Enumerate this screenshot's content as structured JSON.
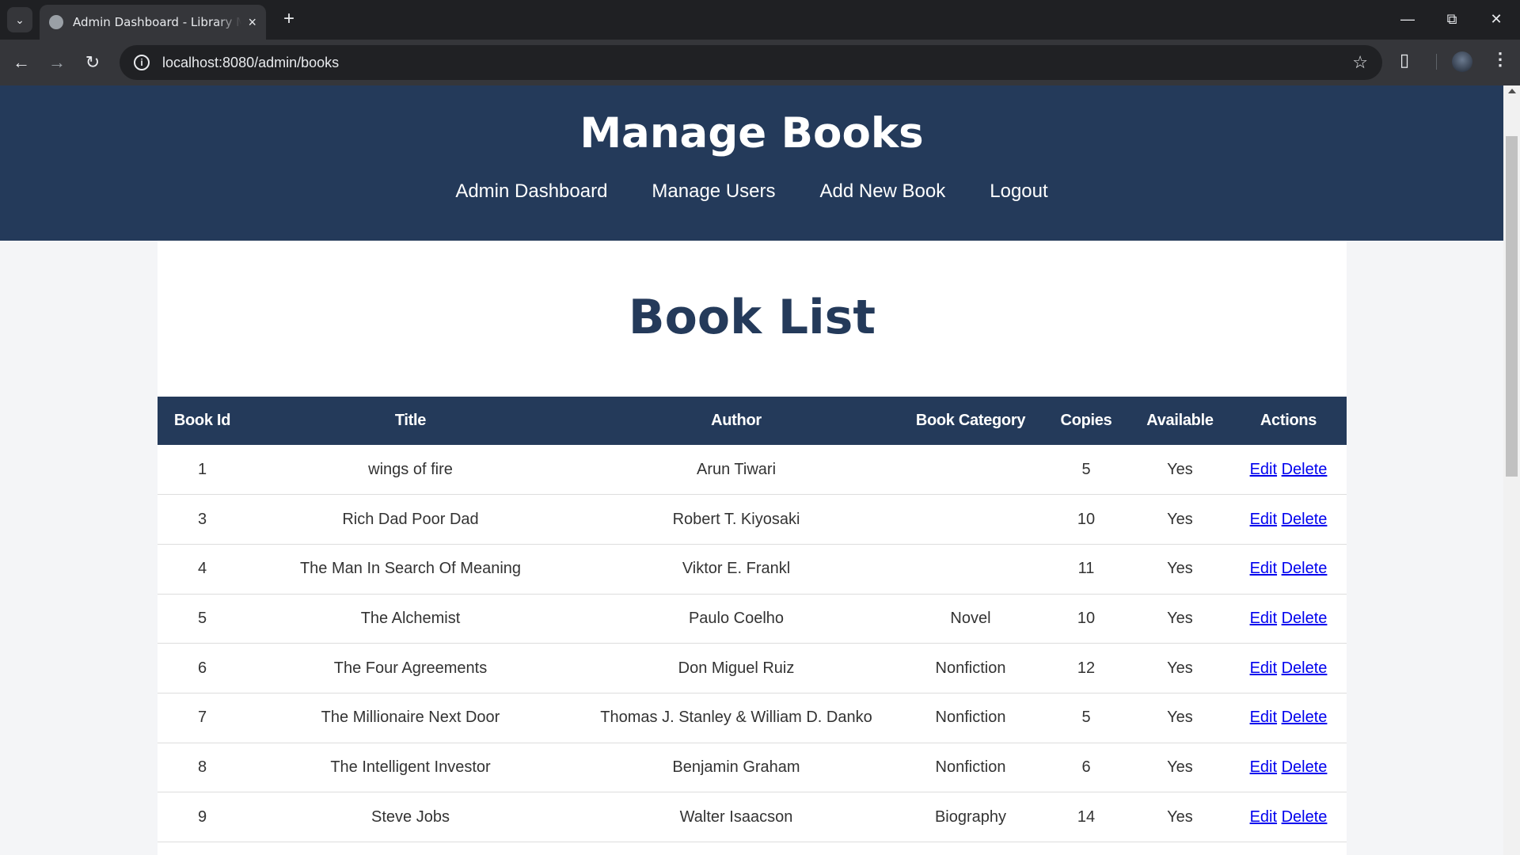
{
  "browser": {
    "tab_title": "Admin Dashboard - Library Management",
    "url": "localhost:8080/admin/books"
  },
  "header": {
    "title": "Manage Books",
    "nav": [
      "Admin Dashboard",
      "Manage Users",
      "Add New Book",
      "Logout"
    ]
  },
  "main": {
    "title": "Book List",
    "columns": [
      "Book Id",
      "Title",
      "Author",
      "Book Category",
      "Copies",
      "Available",
      "Actions"
    ],
    "rows": [
      {
        "id": "1",
        "title": "wings of fire",
        "author": "Arun Tiwari",
        "category": "",
        "copies": "5",
        "available": "Yes",
        "edit": "Edit",
        "delete": "Delete"
      },
      {
        "id": "3",
        "title": "Rich Dad Poor Dad",
        "author": "Robert T. Kiyosaki",
        "category": "",
        "copies": "10",
        "available": "Yes",
        "edit": "Edit",
        "delete": "Delete"
      },
      {
        "id": "4",
        "title": "The Man In Search Of Meaning",
        "author": "Viktor E. Frankl",
        "category": "",
        "copies": "11",
        "available": "Yes",
        "edit": "Edit",
        "delete": "Delete"
      },
      {
        "id": "5",
        "title": "The Alchemist",
        "author": "Paulo Coelho",
        "category": "Novel",
        "copies": "10",
        "available": "Yes",
        "edit": "Edit",
        "delete": "Delete"
      },
      {
        "id": "6",
        "title": "The Four Agreements",
        "author": "Don Miguel Ruiz",
        "category": "Nonfiction",
        "copies": "12",
        "available": "Yes",
        "edit": "Edit",
        "delete": "Delete"
      },
      {
        "id": "7",
        "title": "The Millionaire Next Door",
        "author": "Thomas J. Stanley & William D. Danko",
        "category": "Nonfiction",
        "copies": "5",
        "available": "Yes",
        "edit": "Edit",
        "delete": "Delete"
      },
      {
        "id": "8",
        "title": "The Intelligent Investor",
        "author": "Benjamin Graham",
        "category": "Nonfiction",
        "copies": "6",
        "available": "Yes",
        "edit": "Edit",
        "delete": "Delete"
      },
      {
        "id": "9",
        "title": "Steve Jobs",
        "author": "Walter Isaacson",
        "category": "Biography",
        "copies": "14",
        "available": "Yes",
        "edit": "Edit",
        "delete": "Delete"
      }
    ]
  },
  "colors": {
    "header_bg": "#243a5a",
    "link": "#0000ee"
  }
}
